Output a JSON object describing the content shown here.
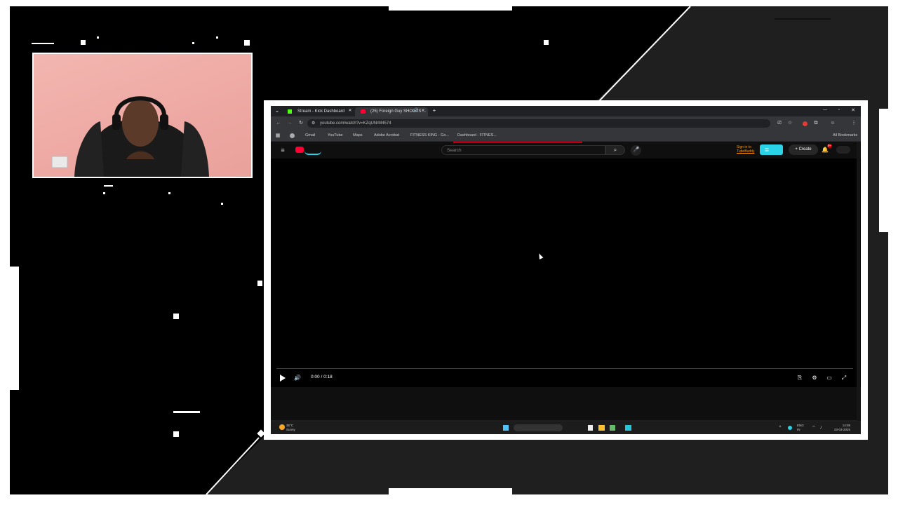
{
  "browser": {
    "tabs": [
      {
        "label": "Stream - Kick Dashboard",
        "active": false
      },
      {
        "label": "(25) Foreign Guy SHOCKS ...",
        "active": true
      }
    ],
    "url": "youtube.com/watch?v=KZqUNrM4574",
    "bookmarks": [
      "Gmail",
      "YouTube",
      "Maps",
      "Adobe Acrobat",
      "FITNESS KING - Go...",
      "Dashboard - FITNES..."
    ],
    "all_bookmarks": "All Bookmarks"
  },
  "youtube": {
    "search_placeholder": "Search",
    "sign_in": "Sign in to",
    "sign_in_sub": "TubeBuddy",
    "create_label": "Create",
    "notif_badge": "9+",
    "time_display": "0:00 / 0:18"
  },
  "taskbar": {
    "weather_temp": "35°C",
    "weather_desc": "Sunny",
    "lang": "ENG",
    "lang_sub": "IN",
    "time": "14:08",
    "date": "23-03-2025"
  },
  "colors": {
    "youtube_red": "#ff0033",
    "accent_cyan": "#2bd3e6",
    "kick_green": "#53fc18",
    "webcam_wall": "#eea8a3"
  }
}
